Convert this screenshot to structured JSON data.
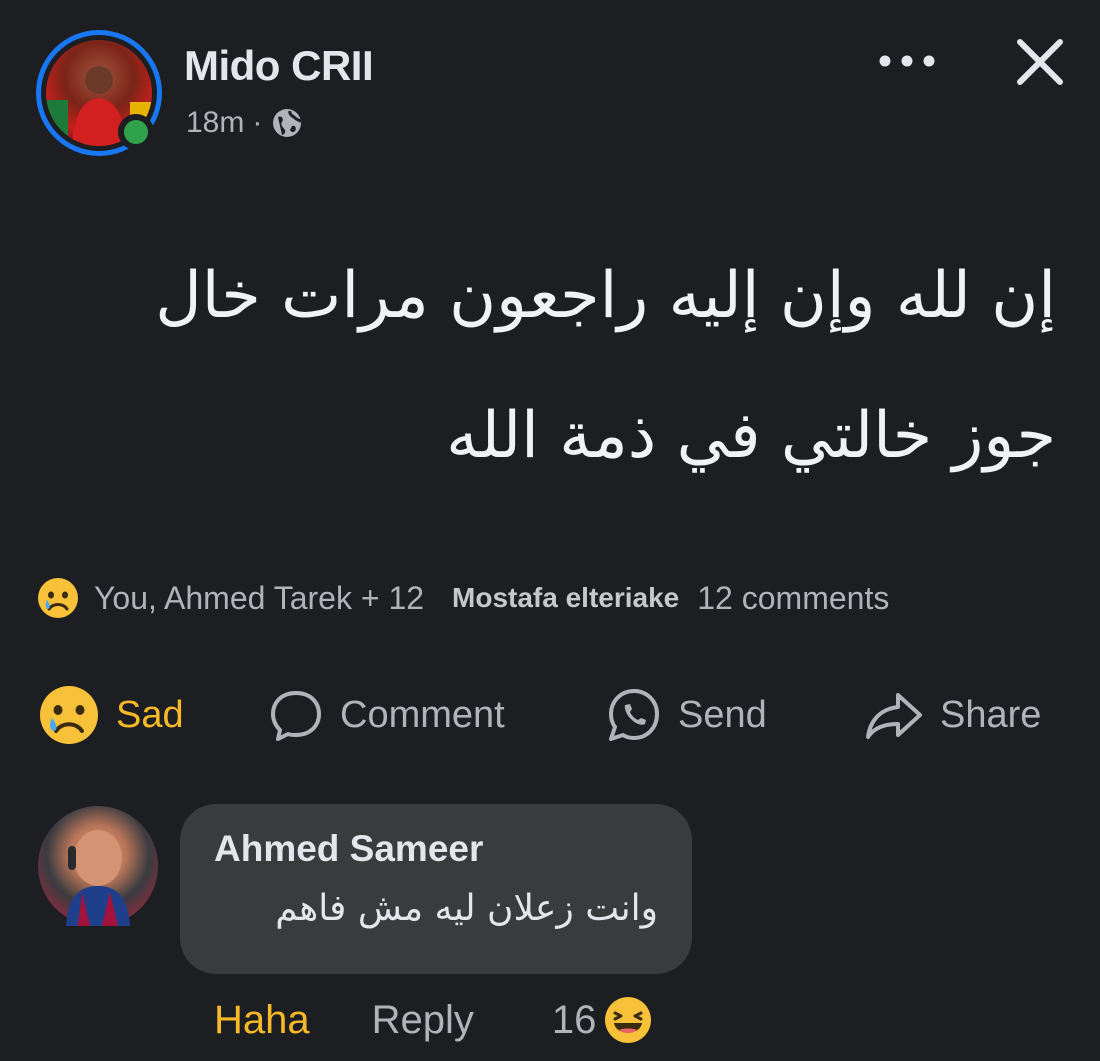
{
  "post": {
    "author": "Mido CRII",
    "time": "18m",
    "separator": "·",
    "privacy_icon": "globe-icon",
    "more_icon": "more-horizontal-icon",
    "close_icon": "close-icon",
    "text_lines": [
      "إن لله وإن إليه راجعون مرات خال",
      "جوز خالتي في ذمة الله"
    ]
  },
  "reactions": {
    "emoji": "sad-emoji-icon",
    "reacted_by": "You, Ahmed Tarek + 12",
    "commenter": "Mostafa elteriake",
    "comments_count": "12 comments"
  },
  "actions": {
    "sad": "Sad",
    "comment": "Comment",
    "send": "Send",
    "share": "Share"
  },
  "comment": {
    "author": "Ahmed Sameer",
    "text": "وانت زعلان ليه مش فاهم",
    "haha": "Haha",
    "reply": "Reply",
    "reaction_count": "16",
    "reaction_icon": "laughing-emoji-icon"
  },
  "colors": {
    "background": "#1d1e21",
    "accent_blue": "#1877f2",
    "online_green": "#31a24c",
    "reaction_yellow": "#f7b928",
    "bubble": "#3a3b3c"
  }
}
